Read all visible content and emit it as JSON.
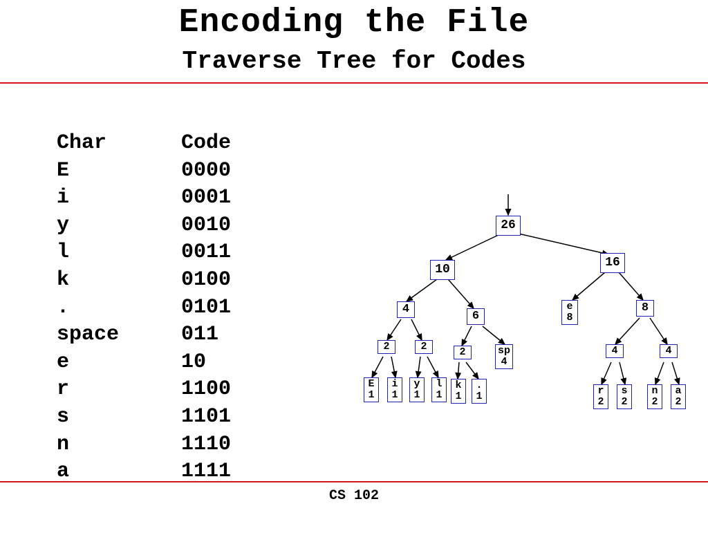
{
  "title": "Encoding the File",
  "subtitle": "Traverse Tree for Codes",
  "footer": "CS 102",
  "table": {
    "headers": {
      "char": "Char",
      "code": "Code"
    },
    "rows": [
      {
        "char": "E",
        "code": "0000"
      },
      {
        "char": "i",
        "code": "0001"
      },
      {
        "char": "y",
        "code": "0010"
      },
      {
        "char": "l",
        "code": "0011"
      },
      {
        "char": "k",
        "code": "0100"
      },
      {
        "char": ".",
        "code": "0101"
      },
      {
        "char": "space",
        "code": "011"
      },
      {
        "char": "e",
        "code": "10"
      },
      {
        "char": "r",
        "code": "1100"
      },
      {
        "char": "s",
        "code": "1101"
      },
      {
        "char": "n",
        "code": "1110"
      },
      {
        "char": "a",
        "code": "1111"
      }
    ]
  },
  "tree": {
    "root": "26",
    "n10": "10",
    "n16": "16",
    "n4a": "4",
    "n6": "6",
    "e8_char": "e",
    "e8_freq": "8",
    "n8": "8",
    "n2a": "2",
    "n2b": "2",
    "n2c": "2",
    "sp_char": "sp",
    "sp_freq": "4",
    "n4b": "4",
    "n4c": "4",
    "E_char": "E",
    "E_freq": "1",
    "i_char": "i",
    "i_freq": "1",
    "y_char": "y",
    "y_freq": "1",
    "l_char": "l",
    "l_freq": "1",
    "k_char": "k",
    "k_freq": "1",
    "dot_char": ".",
    "dot_freq": "1",
    "r_char": "r",
    "r_freq": "2",
    "s_char": "s",
    "s_freq": "2",
    "n_char": "n",
    "n_freq": "2",
    "a_char": "a",
    "a_freq": "2"
  }
}
